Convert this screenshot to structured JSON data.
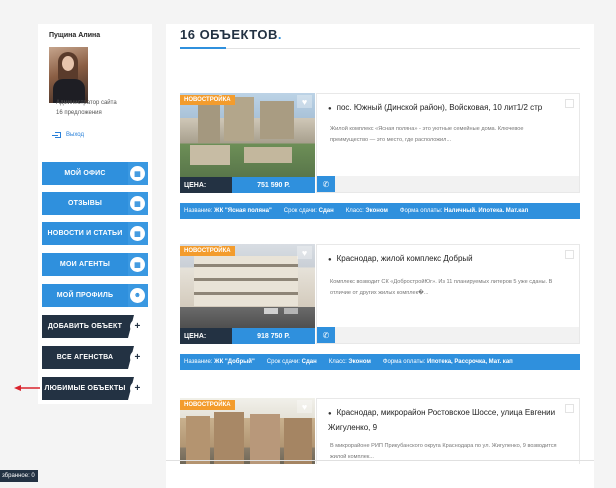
{
  "user": {
    "name": "Пущина Алина",
    "role": "Администратор сайта",
    "listings_count": "16 предложения",
    "logout": "Выход"
  },
  "nav": [
    {
      "label": "МОЙ ОФИС",
      "style": "blue",
      "icon": "grid-icon"
    },
    {
      "label": "ОТЗЫВЫ",
      "style": "blue",
      "icon": "grid-icon"
    },
    {
      "label": "НОВОСТИ И СТАТЬИ",
      "style": "blue",
      "icon": "grid-icon"
    },
    {
      "label": "МОИ АГЕНТЫ",
      "style": "blue",
      "icon": "grid-icon"
    },
    {
      "label": "МОЙ ПРОФИЛЬ",
      "style": "blue",
      "icon": "user-icon"
    },
    {
      "label": "ДОБАВИТЬ ОБЪЕКТ",
      "style": "dark",
      "icon": "plus-icon",
      "glyph": "+"
    },
    {
      "label": "ВСЕ АГЕНСТВА",
      "style": "dark",
      "icon": "plus-icon",
      "glyph": "+"
    },
    {
      "label": "ЛЮБИМЫЕ ОБЪЕКТЫ",
      "style": "dark",
      "icon": "plus-icon",
      "glyph": "+"
    }
  ],
  "favorites_bar": "збранное: 0",
  "header": {
    "count_title": "16 ОБЪЕКТОВ",
    "dot": "."
  },
  "listings": [
    {
      "badge": "НОВОСТРОЙКА",
      "price_label": "ЦЕНА:",
      "price": "751 590 Р.",
      "address": "пос. Южный (Динской район), Войсковая, 10 лит1/2 стр",
      "description": "Жилой комплекс «Ясная поляна» - это уютные семейные дома. Ключевое преимущество — это место, где расположил...",
      "info": {
        "name_label": "Название:",
        "name": "ЖК \"Ясная поляна\"",
        "deadline_label": "Срок сдачи:",
        "deadline": "Сдан",
        "class_label": "Класс:",
        "class": "Эконом",
        "payment_label": "Форма оплаты:",
        "payment": "Наличный. Ипотека. Мат.кап"
      }
    },
    {
      "badge": "НОВОСТРОЙКА",
      "price_label": "ЦЕНА:",
      "price": "918 750 Р.",
      "address": "Краснодар, жилой комплекс Добрый",
      "description": "Комплекс возводит СК «ДобростройЮг». Из 11 планируемых литеров 5 уже сданы. В отличие от других жилых комплек�...",
      "info": {
        "name_label": "Название:",
        "name": "ЖК \"Добрый\"",
        "deadline_label": "Срок сдачи:",
        "deadline": "Сдан",
        "class_label": "Класс:",
        "class": "Эконом",
        "payment_label": "Форма оплаты:",
        "payment": "Ипотека, Рассрочка, Мат. кап"
      }
    },
    {
      "badge": "НОВОСТРОЙКА",
      "address": "Краснодар, микрорайон Ростовское Шоссе, улица Евгении Жигуленко, 9",
      "description": "В микрорайоне РИП Прикубанского округа Краснодара по ул. Жигуленко, 9 возводится жилой комплек..."
    }
  ],
  "colors": {
    "accent_blue": "#2f90dd",
    "dark_navy": "#233243",
    "badge_orange": "#f39c2d",
    "arrow_red": "#d9232d"
  }
}
